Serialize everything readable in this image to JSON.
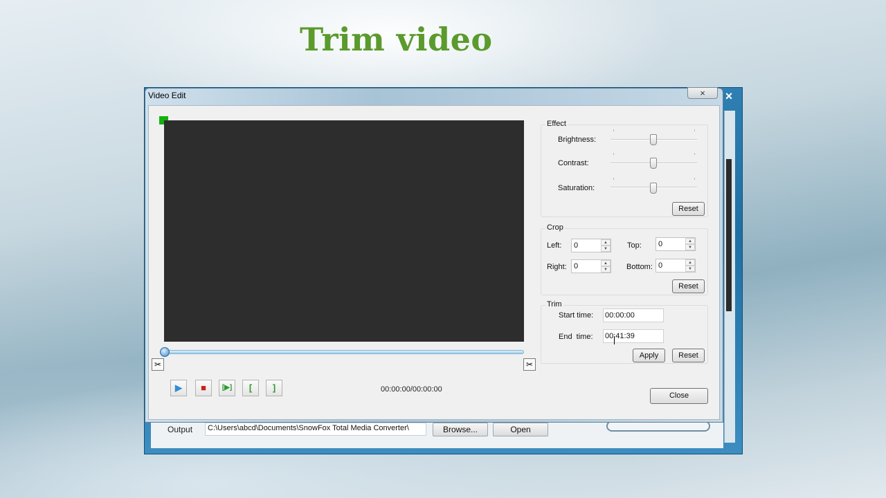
{
  "slide_title": "Trim video",
  "background_window": {
    "output_label": "Output",
    "output_path": "C:\\Users\\abcd\\Documents\\SnowFox Total Media Converter\\",
    "browse_label": "Browse...",
    "open_label": "Open",
    "close_glyph": "×"
  },
  "dialog": {
    "title": "Video Edit",
    "close_glyph": "×",
    "player": {
      "time_readout": "00:00:00/00:00:00",
      "play_glyph": "▶",
      "stop_glyph": "■",
      "trim_play_glyph": "[▶]",
      "mark_start_glyph": "[",
      "mark_end_glyph": "]",
      "scissor_glyph": "✂"
    },
    "effect": {
      "label": "Effect",
      "brightness_label": "Brightness:",
      "contrast_label": "Contrast:",
      "saturation_label": "Saturation:",
      "brightness_level": 0.5,
      "contrast_level": 0.5,
      "saturation_level": 0.5,
      "reset_label": "Reset"
    },
    "crop": {
      "label": "Crop",
      "left_label": "Left:",
      "left_value": "0",
      "top_label": "Top:",
      "top_value": "0",
      "right_label": "Right:",
      "right_value": "0",
      "bottom_label": "Bottom:",
      "bottom_value": "0",
      "reset_label": "Reset"
    },
    "trim": {
      "label": "Trim",
      "start_label": "Start time:",
      "start_value": "00:00:00",
      "end_label": "End  time:",
      "end_value": "00:41:39",
      "apply_label": "Apply",
      "reset_label": "Reset"
    },
    "close_label": "Close"
  },
  "colors": {
    "title_green": "#5b9a2d",
    "marker_green": "#13b10e",
    "stop_red": "#cc1f1a",
    "play_blue": "#2f8fd0"
  }
}
